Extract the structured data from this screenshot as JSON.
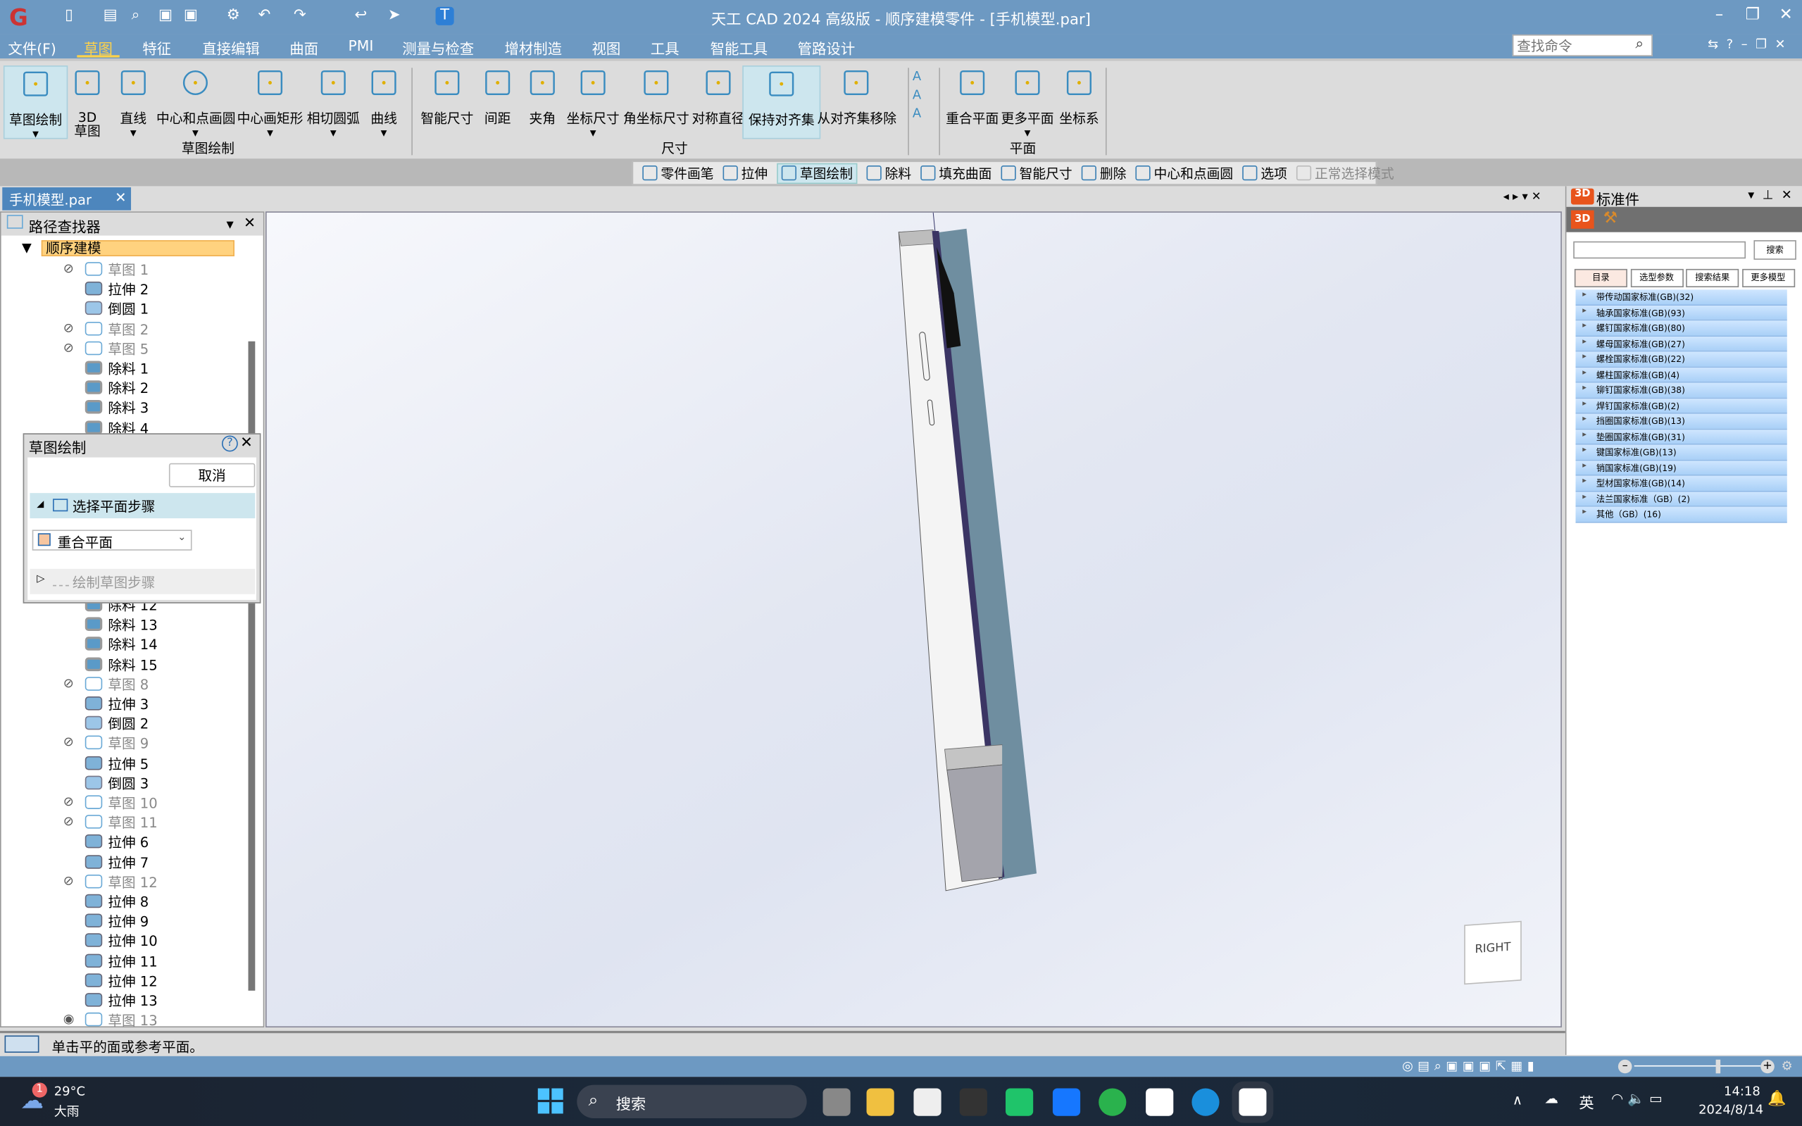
{
  "window": {
    "title": "天工 CAD 2024 高级版 - 顺序建模零件 - [手机模型.par]",
    "min": "–",
    "max": "❐",
    "close": "✕"
  },
  "menu": [
    "文件(F)",
    "草图",
    "特征",
    "直接编辑",
    "曲面",
    "PMI",
    "测量与检查",
    "增材制造",
    "视图",
    "工具",
    "智能工具",
    "管路设计"
  ],
  "menu_active": "草图",
  "search_command": {
    "placeholder": "查找命令"
  },
  "ribbon": {
    "groups": [
      {
        "label": "草图绘制"
      },
      {
        "label": "尺寸"
      },
      {
        "label": "平面"
      }
    ],
    "buttons": [
      {
        "label": "草图绘制",
        "icon": "sketch-pencil-icon",
        "active": true
      },
      {
        "label": "3D",
        "label2": "草图",
        "icon": "3d-sketch-icon"
      },
      {
        "label": "直线",
        "icon": "line-icon"
      },
      {
        "label": "中心和点画圆",
        "icon": "circle-icon"
      },
      {
        "label": "中心画矩形",
        "icon": "rectangle-icon"
      },
      {
        "label": "相切圆弧",
        "icon": "arc-icon"
      },
      {
        "label": "曲线",
        "icon": "curve-icon"
      },
      {
        "label": "智能尺寸",
        "icon": "smart-dimension-icon"
      },
      {
        "label": "间距",
        "icon": "distance-icon"
      },
      {
        "label": "夹角",
        "icon": "angle-icon"
      },
      {
        "label": "坐标尺寸",
        "icon": "coordinate-dimension-icon"
      },
      {
        "label": "角坐标尺寸",
        "icon": "angular-coordinate-icon"
      },
      {
        "label": "对称直径",
        "icon": "symmetric-diameter-icon"
      },
      {
        "label": "保持对齐集",
        "icon": "keep-alignment-icon",
        "active": true
      },
      {
        "label": "从对齐集移除",
        "icon": "remove-alignment-icon"
      },
      {
        "label": "重合平面",
        "icon": "coincident-plane-icon"
      },
      {
        "label": "更多平面",
        "icon": "more-planes-icon"
      },
      {
        "label": "坐标系",
        "icon": "coordinate-system-icon"
      }
    ]
  },
  "command_bar": [
    {
      "label": "零件画笔",
      "icon": "part-pen-icon"
    },
    {
      "label": "拉伸",
      "icon": "extrude-icon"
    },
    {
      "label": "草图绘制",
      "icon": "sketch-icon",
      "active": true
    },
    {
      "label": "除料",
      "icon": "cut-icon"
    },
    {
      "label": "填充曲面",
      "icon": "fill-surface-icon"
    },
    {
      "label": "智能尺寸",
      "icon": "smart-dimension-icon"
    },
    {
      "label": "删除",
      "icon": "delete-icon"
    },
    {
      "label": "中心和点画圆",
      "icon": "circle-icon"
    },
    {
      "label": "选项",
      "icon": "gear-icon"
    },
    {
      "label": "正常选择模式",
      "icon": "select-icon",
      "disabled": true
    }
  ],
  "document_tab": {
    "label": "手机模型.par"
  },
  "pathfinder": {
    "title": "路径查找器",
    "root": "顺序建模",
    "items_top": [
      {
        "label": "草图 1",
        "type": "sketch",
        "hidden": true
      },
      {
        "label": "拉伸 2",
        "type": "extrude"
      },
      {
        "label": "倒圆 1",
        "type": "fillet"
      },
      {
        "label": "草图 2",
        "type": "sketch",
        "hidden": true
      },
      {
        "label": "草图 5",
        "type": "sketch",
        "hidden": true
      },
      {
        "label": "除料 1",
        "type": "cut"
      },
      {
        "label": "除料 2",
        "type": "cut"
      },
      {
        "label": "除料 3",
        "type": "cut"
      },
      {
        "label": "除料 4",
        "type": "cut"
      }
    ],
    "items_bottom": [
      {
        "label": "除料 12",
        "type": "cut"
      },
      {
        "label": "除料 13",
        "type": "cut"
      },
      {
        "label": "除料 14",
        "type": "cut"
      },
      {
        "label": "除料 15",
        "type": "cut"
      },
      {
        "label": "草图 8",
        "type": "sketch",
        "hidden": true
      },
      {
        "label": "拉伸 3",
        "type": "extrude"
      },
      {
        "label": "倒圆 2",
        "type": "fillet"
      },
      {
        "label": "草图 9",
        "type": "sketch",
        "hidden": true
      },
      {
        "label": "拉伸 5",
        "type": "extrude"
      },
      {
        "label": "倒圆 3",
        "type": "fillet"
      },
      {
        "label": "草图 10",
        "type": "sketch",
        "hidden": true
      },
      {
        "label": "草图 11",
        "type": "sketch",
        "hidden": true
      },
      {
        "label": "拉伸 6",
        "type": "extrude"
      },
      {
        "label": "拉伸 7",
        "type": "extrude"
      },
      {
        "label": "草图 12",
        "type": "sketch",
        "hidden": true
      },
      {
        "label": "拉伸 8",
        "type": "extrude"
      },
      {
        "label": "拉伸 9",
        "type": "extrude"
      },
      {
        "label": "拉伸 10",
        "type": "extrude"
      },
      {
        "label": "拉伸 11",
        "type": "extrude"
      },
      {
        "label": "拉伸 12",
        "type": "extrude"
      },
      {
        "label": "拉伸 13",
        "type": "extrude"
      },
      {
        "label": "草图 13",
        "type": "sketch",
        "hidden": false
      }
    ]
  },
  "sketch_dialog": {
    "title": "草图绘制",
    "cancel": "取消",
    "step1": "选择平面步骤",
    "plane_select": "重合平面",
    "step2": "绘制草图步骤"
  },
  "view_cube": {
    "label": "RIGHT"
  },
  "standard_parts": {
    "title": "标准件",
    "search_button": "搜索",
    "search_value": "",
    "tabs": [
      "目录",
      "选型参数",
      "搜索结果",
      "更多模型"
    ],
    "active_tab": "目录",
    "categories": [
      "带传动国家标准(GB)(32)",
      "轴承国家标准(GB)(93)",
      "螺钉国家标准(GB)(80)",
      "螺母国家标准(GB)(27)",
      "螺栓国家标准(GB)(22)",
      "螺柱国家标准(GB)(4)",
      "铆钉国家标准(GB)(38)",
      "焊钉国家标准(GB)(2)",
      "挡圈国家标准(GB)(13)",
      "垫圈国家标准(GB)(31)",
      "键国家标准(GB)(13)",
      "销国家标准(GB)(19)",
      "型材国家标准(GB)(14)",
      "法兰国家标准（GB）(2)",
      "其他（GB）(16)"
    ]
  },
  "status": {
    "prompt": "单击平的面或参考平面。"
  },
  "taskbar": {
    "weather_temp": "29°C",
    "weather_desc": "大雨",
    "weather_badge": "1",
    "search": "搜索",
    "ime": "英",
    "time": "14:18",
    "date": "2024/8/14"
  },
  "colors": {
    "title_bar": "#6d99c2",
    "accent_tab": "#ffd24a",
    "root_highlight": "#ffd27f",
    "category_row": "#b9dafb"
  }
}
